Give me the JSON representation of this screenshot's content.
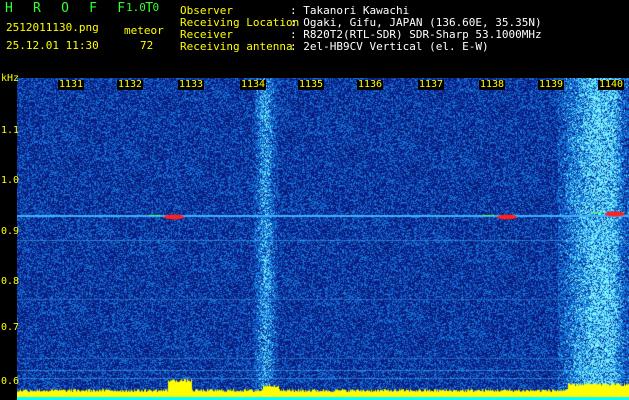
{
  "header": {
    "app_title": "H R O F F T",
    "version": "1.0.0",
    "filename": "2512011130.png",
    "datetime": "25.12.01 11:30",
    "meteor_label": "meteor",
    "meteor_count": "72",
    "info": [
      {
        "key": "Observer",
        "value": ": Takanori Kawachi"
      },
      {
        "key": "Receiving Location",
        "value": ": Ogaki, Gifu, JAPAN (136.60E, 35.35N)"
      },
      {
        "key": "Receiver",
        "value": ": R820T2(RTL-SDR) SDR-Sharp 53.1000MHz"
      },
      {
        "key": "Receiving antenna",
        "value": ": 2el-HB9CV Vertical (el. E-W)"
      }
    ]
  },
  "spectrogram": {
    "y_unit": "kHz",
    "y_ticks": [
      "1.1",
      "1.0",
      "0.9",
      "0.8",
      "0.7",
      "0.6"
    ],
    "x_ticks": [
      "1131",
      "1132",
      "1133",
      "1134",
      "1135",
      "1136",
      "1137",
      "1138",
      "1139",
      "1140"
    ],
    "colors": {
      "background": "#0a1a7a",
      "noise": "#1e4fc8",
      "bright": "#40c0ff",
      "signal": "#ff2020",
      "baseline": "#ffff00"
    }
  }
}
